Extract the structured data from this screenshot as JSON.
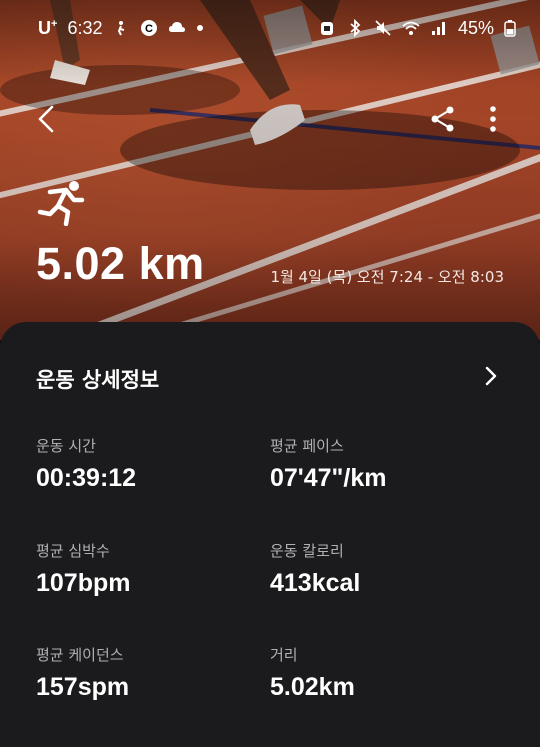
{
  "status_bar": {
    "carrier": "U",
    "carrier_super": "+",
    "time": "6:32",
    "battery": "45%",
    "icons": [
      "person-walk-icon",
      "c-badge-icon",
      "cloud-icon",
      "dot-icon",
      "alarm-icon",
      "bluetooth-icon",
      "mute-icon",
      "wifi-icon",
      "signal-icon",
      "battery-icon"
    ]
  },
  "toolbar": {
    "back_icon": "back-arrow-icon",
    "share_icon": "share-icon",
    "more_icon": "more-vertical-icon"
  },
  "hero": {
    "activity_icon": "running-icon",
    "distance": "5.02 km",
    "datetime": "1월 4일 (목) 오전 7:24 - 오전 8:03"
  },
  "details": {
    "title": "운동 상세정보",
    "metrics": [
      {
        "label": "운동 시간",
        "value": "00:39:12",
        "unit": ""
      },
      {
        "label": "평균 페이스",
        "value": "07'47\"/km",
        "unit": ""
      },
      {
        "label": "평균 심박수",
        "value": "107",
        "unit": "bpm"
      },
      {
        "label": "운동 칼로리",
        "value": "413",
        "unit": "kcal"
      },
      {
        "label": "평균 케이던스",
        "value": "157",
        "unit": "spm"
      },
      {
        "label": "거리",
        "value": "5.02",
        "unit": "km"
      }
    ]
  },
  "colors": {
    "track": "#a8452a",
    "card_bg": "#1b1b1d",
    "label": "#b0b0b3"
  }
}
